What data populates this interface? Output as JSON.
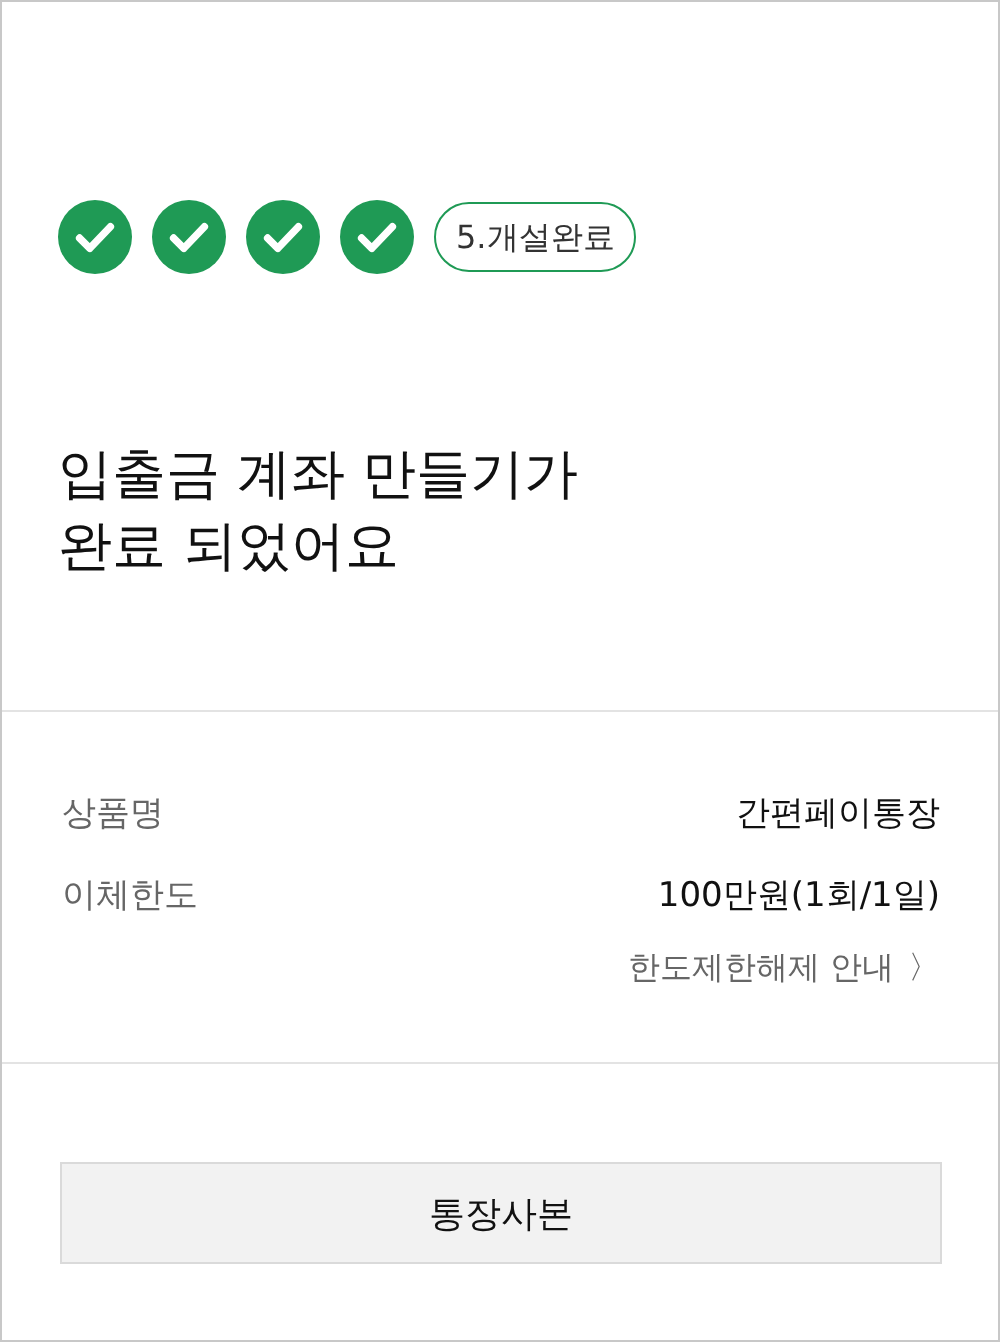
{
  "steps": [
    {
      "kind": "done"
    },
    {
      "kind": "done"
    },
    {
      "kind": "done"
    },
    {
      "kind": "done"
    },
    {
      "kind": "current",
      "label": "5.개설완료"
    }
  ],
  "title": [
    "입출금 계좌 만들기가",
    "완료 되었어요"
  ],
  "details": [
    {
      "label": "상품명",
      "value": "간편페이통장"
    },
    {
      "label": "이체한도",
      "value": "100만원(1회/1일)"
    }
  ],
  "limit_link": {
    "label": "한도제한해제 안내",
    "arrow": "〉"
  },
  "buttons": [
    "통장사본"
  ]
}
